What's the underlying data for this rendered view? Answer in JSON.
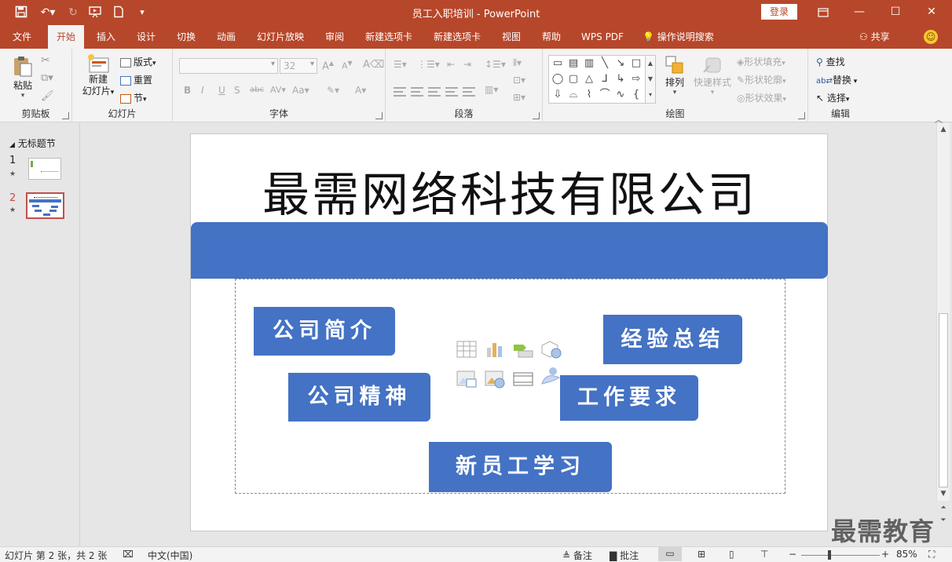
{
  "window": {
    "doc_name": "员工入职培训",
    "app_name": "PowerPoint",
    "separator": "-",
    "login_label": "登录"
  },
  "ribbon_tabs": [
    {
      "label": "文件"
    },
    {
      "label": "开始",
      "active": true
    },
    {
      "label": "插入"
    },
    {
      "label": "设计"
    },
    {
      "label": "切换"
    },
    {
      "label": "动画"
    },
    {
      "label": "幻灯片放映"
    },
    {
      "label": "审阅"
    },
    {
      "label": "新建选项卡"
    },
    {
      "label": "新建选项卡"
    },
    {
      "label": "视图"
    },
    {
      "label": "帮助"
    },
    {
      "label": "WPS PDF"
    },
    {
      "label": "操作说明搜索"
    }
  ],
  "share_label": "共享",
  "groups": {
    "clipboard": {
      "label": "剪贴板",
      "paste": "粘贴"
    },
    "slides": {
      "label": "幻灯片",
      "new_slide_1": "新建",
      "new_slide_2": "幻灯片",
      "layout": "版式",
      "reset": "重置",
      "section": "节"
    },
    "font": {
      "label": "字体",
      "size": "32"
    },
    "paragraph": {
      "label": "段落"
    },
    "drawing": {
      "label": "绘图",
      "arrange": "排列",
      "quick_styles": "快速样式",
      "shape_fill": "形状填充",
      "shape_outline": "形状轮廓",
      "shape_effects": "形状效果"
    },
    "editing": {
      "label": "编辑",
      "find": "查找",
      "replace": "替换",
      "select": "选择"
    }
  },
  "slide_panel": {
    "section": "无标题节",
    "thumbnails": [
      {
        "number": "1",
        "selected": false
      },
      {
        "number": "2",
        "selected": true
      }
    ]
  },
  "slide": {
    "title": "最需网络科技有限公司",
    "items": [
      {
        "text": "公司简介"
      },
      {
        "text": "经验总结"
      },
      {
        "text": "公司精神"
      },
      {
        "text": "工作要求"
      },
      {
        "text": "新员工学习"
      }
    ]
  },
  "watermark": "最需教育",
  "status": {
    "slide_info": "幻灯片 第 2 张，共 2 张",
    "language": "中文(中国)",
    "notes": "备注",
    "comments": "批注",
    "zoom": "85%"
  },
  "colors": {
    "title_bar": "#b7472a",
    "accent_blue": "#4472c4"
  }
}
